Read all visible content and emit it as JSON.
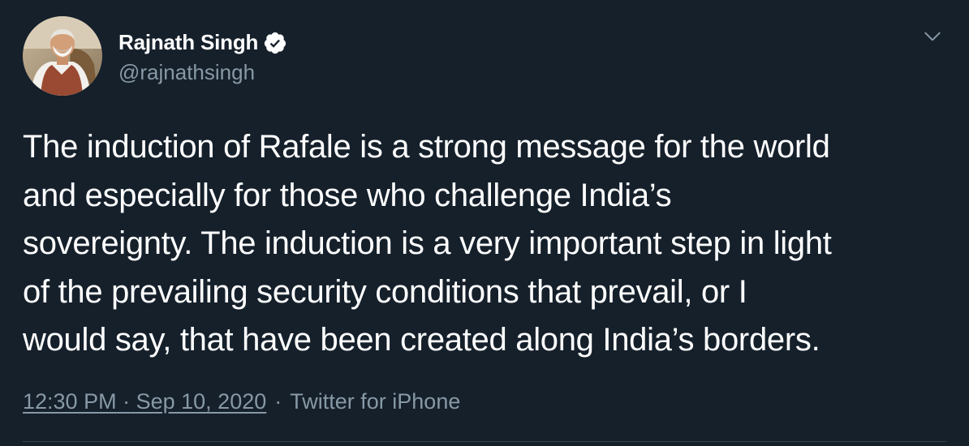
{
  "tweet": {
    "author": {
      "display_name": "Rajnath Singh",
      "handle": "@rajnathsingh",
      "verified": true
    },
    "text_lines": [
      "The induction of Rafale is a strong message for the world",
      "and especially for those who challenge India’s",
      "sovereignty. The induction is a very important step in light",
      "of the prevailing security conditions that prevail, or I",
      "would say, that have been created along India’s borders."
    ],
    "time": "12:30 PM",
    "date": "Sep 10, 2020",
    "separator": "·",
    "source": "Twitter for iPhone"
  },
  "icons": {
    "verified": "verified-badge-icon",
    "caret": "chevron-down-icon"
  },
  "colors": {
    "background": "#15202b",
    "text_primary": "#ffffff",
    "text_secondary": "#8899a6",
    "divider": "#38444d"
  }
}
